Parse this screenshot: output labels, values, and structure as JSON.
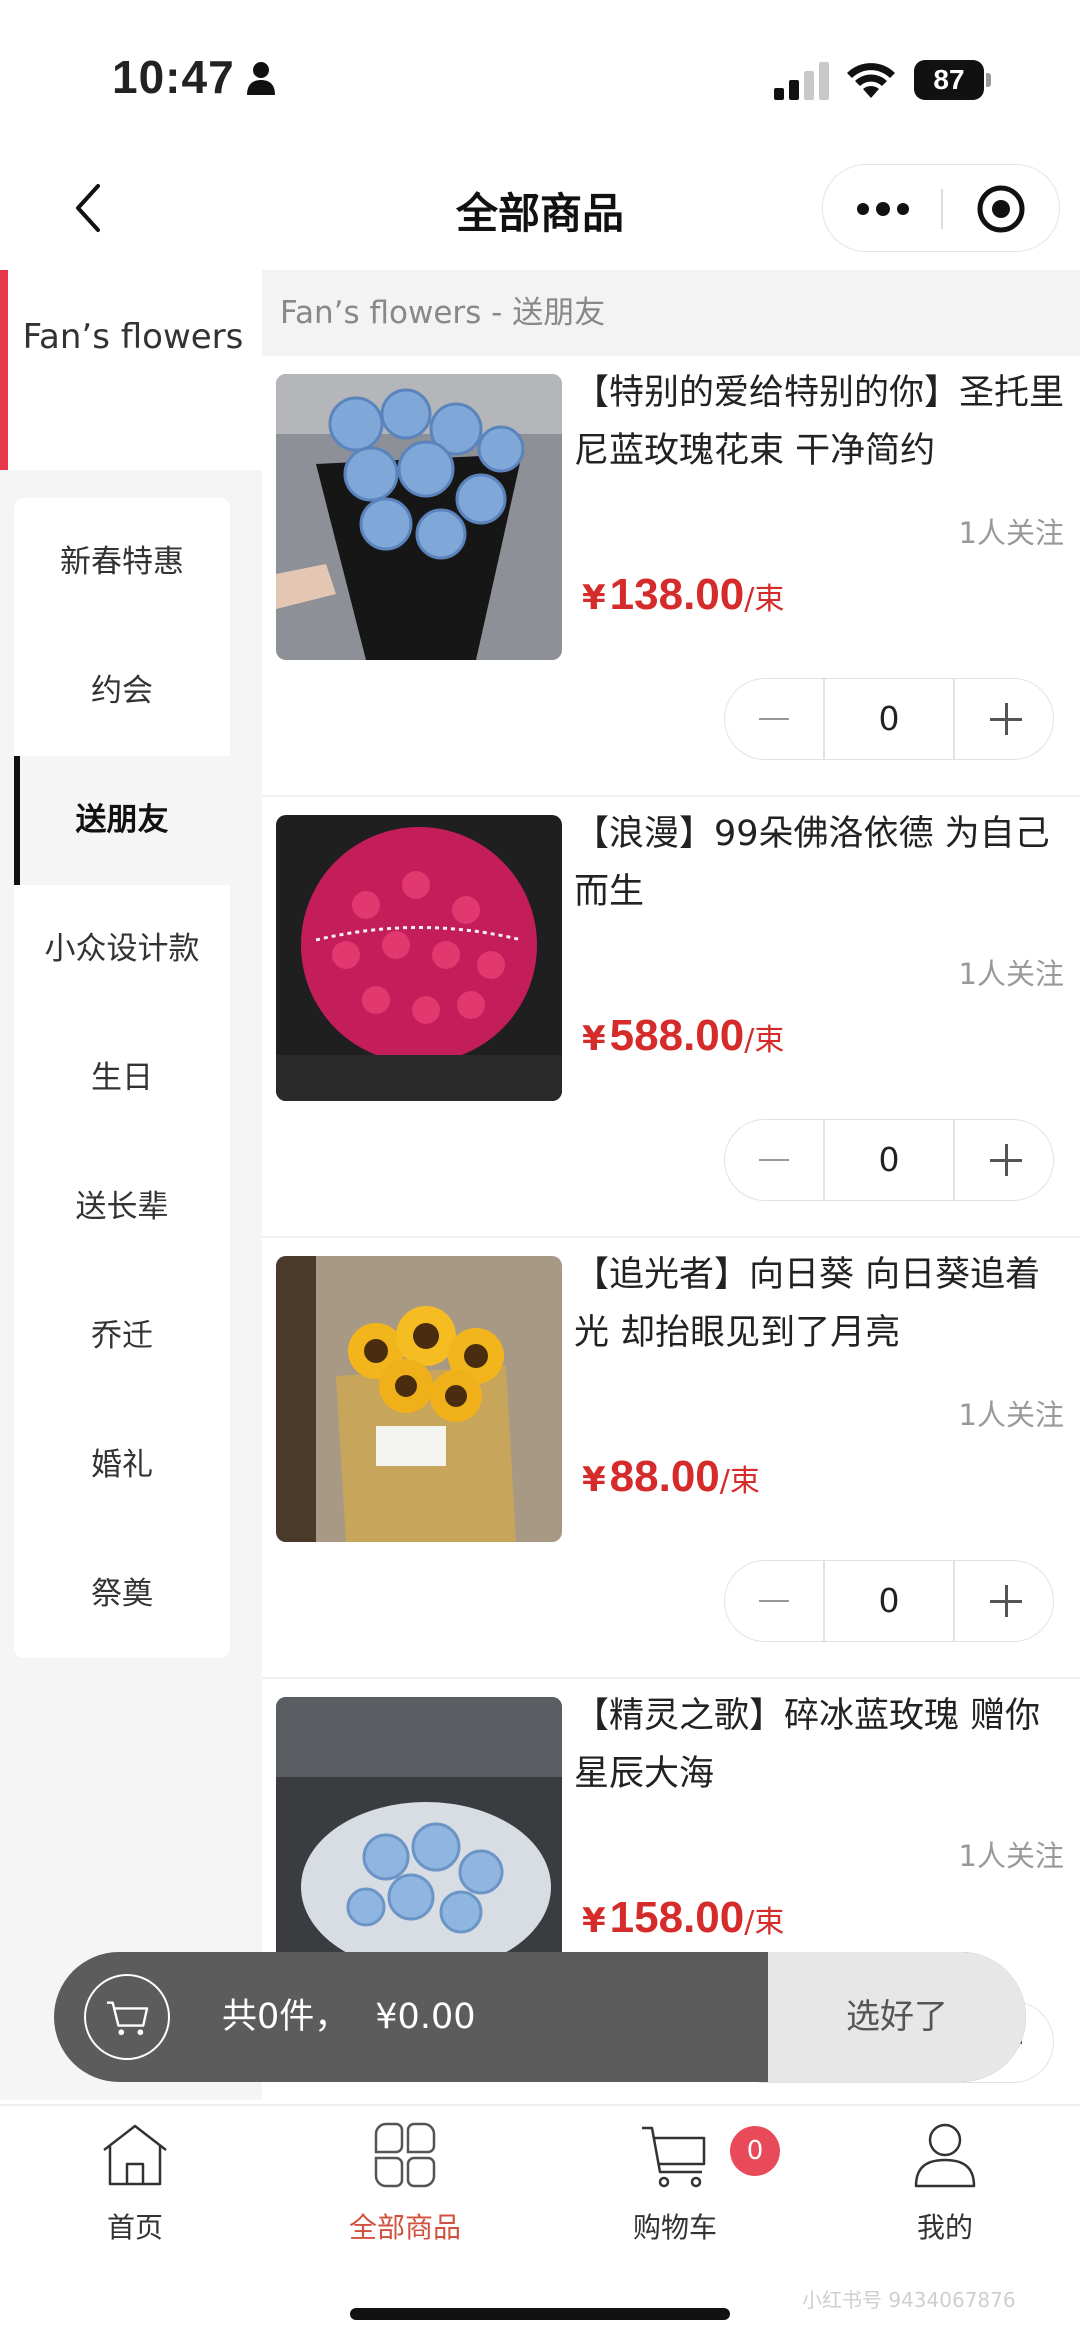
{
  "status": {
    "time": "10:47",
    "battery": "87"
  },
  "nav": {
    "title": "全部商品"
  },
  "sidebar": {
    "shop_name": "Fan’s flowers",
    "categories": [
      {
        "label": "新春特惠",
        "active": false
      },
      {
        "label": "约会",
        "active": false
      },
      {
        "label": "送朋友",
        "active": true
      },
      {
        "label": "小众设计款",
        "active": false
      },
      {
        "label": "生日",
        "active": false
      },
      {
        "label": "送长辈",
        "active": false
      },
      {
        "label": "乔迁",
        "active": false
      },
      {
        "label": "婚礼",
        "active": false
      },
      {
        "label": "祭奠",
        "active": false
      }
    ]
  },
  "section": {
    "header": "Fan’s flowers - 送朋友"
  },
  "currency_symbol": "¥",
  "unit": "/束",
  "products": [
    {
      "title": "【特别的爱给特别的你】圣托里尼蓝玫瑰花束 干净简约",
      "followers": "1人关注",
      "price": "138.00",
      "qty": "0",
      "image": "blue-rose-bouquet"
    },
    {
      "title": "【浪漫】99朵佛洛依德 为自己而生",
      "followers": "1人关注",
      "price": "588.00",
      "qty": "0",
      "image": "red-rose-bouquet"
    },
    {
      "title": "【追光者】向日葵 向日葵追着光 却抬眼见到了月亮",
      "followers": "1人关注",
      "price": "88.00",
      "qty": "0",
      "image": "sunflower-bouquet"
    },
    {
      "title": "【精灵之歌】碎冰蓝玫瑰 赠你星辰大海",
      "followers": "1人关注",
      "price": "158.00",
      "qty": "0",
      "image": "ice-blue-rose-bouquet"
    }
  ],
  "cart": {
    "summary_count": "共0件，",
    "summary_total": "¥0.00",
    "confirm_label": "选好了"
  },
  "tabs": [
    {
      "label": "首页",
      "icon": "home-icon",
      "active": false
    },
    {
      "label": "全部商品",
      "icon": "grid-icon",
      "active": true
    },
    {
      "label": "购物车",
      "icon": "cart-icon",
      "active": false,
      "badge": "0"
    },
    {
      "label": "我的",
      "icon": "user-icon",
      "active": false
    }
  ],
  "watermark": "小红书号 9434067876",
  "colors": {
    "accent": "#e7374a",
    "price": "#d62b2b",
    "active_tab": "#d0513d",
    "cart_bar": "#5c5c5c"
  }
}
